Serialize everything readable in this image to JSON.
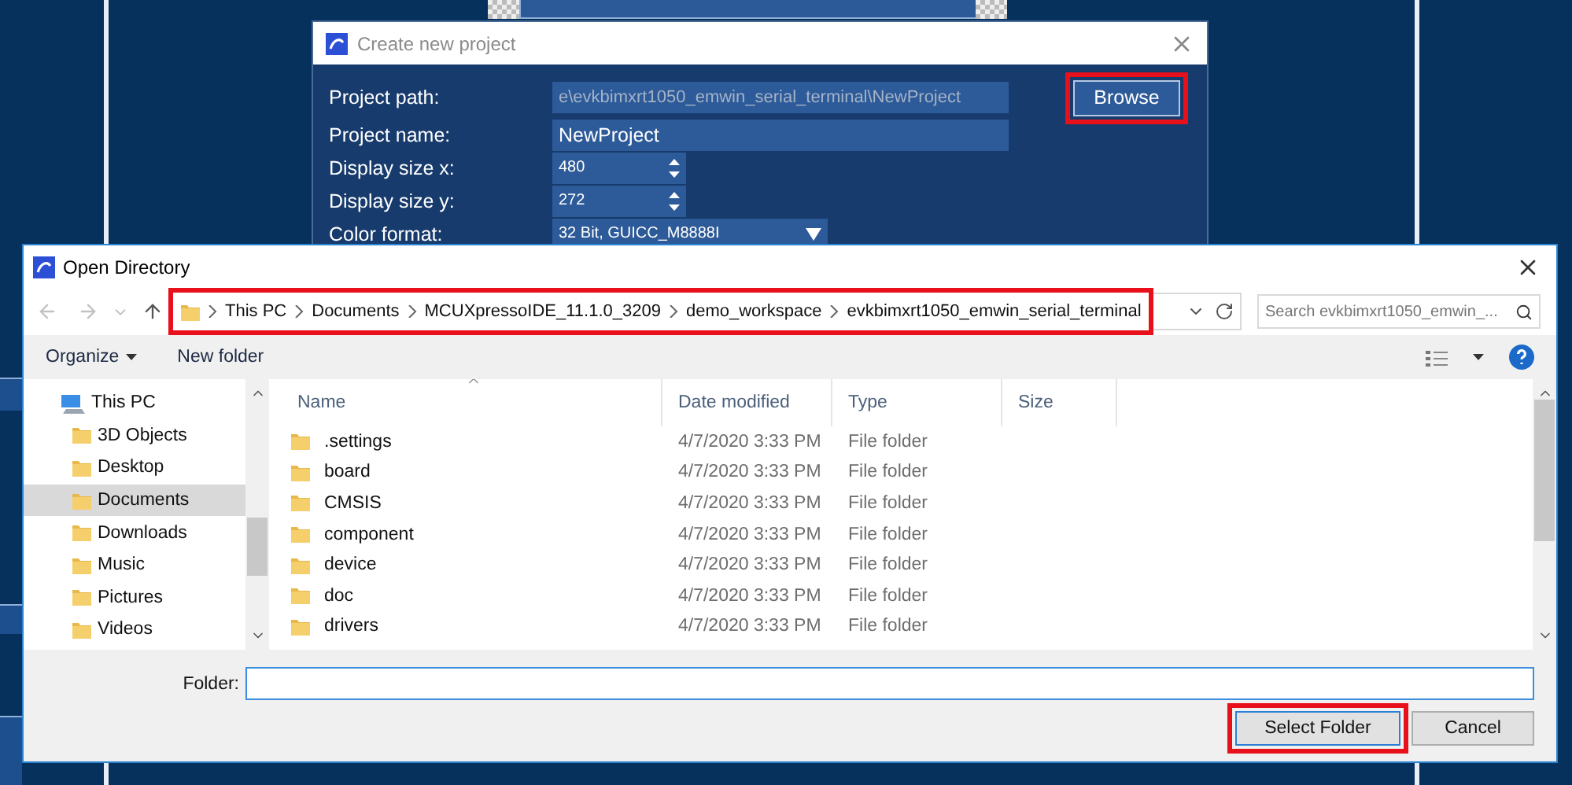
{
  "project_dialog": {
    "title": "Create new project",
    "fields": [
      {
        "label": "Project path:",
        "value": "e\\evkbimxrt1050_emwin_serial_terminal\\NewProject",
        "kind": "text",
        "disabled": true
      },
      {
        "label": "Project name:",
        "value": "NewProject",
        "kind": "text",
        "disabled": false
      },
      {
        "label": "Display size x:",
        "value": "480",
        "kind": "spin",
        "disabled": false
      },
      {
        "label": "Display size y:",
        "value": "272",
        "kind": "spin",
        "disabled": false
      },
      {
        "label": "Color format:",
        "value": "32 Bit, GUICC_M8888I",
        "kind": "select",
        "disabled": false
      }
    ],
    "browse_button": {
      "label": "Browse",
      "highlighted": true
    }
  },
  "open_dialog": {
    "title": "Open Directory",
    "breadcrumb": {
      "highlighted": true,
      "items": [
        "This PC",
        "Documents",
        "MCUXpressoIDE_11.1.0_3209",
        "demo_workspace",
        "evkbimxrt1050_emwin_serial_terminal"
      ]
    },
    "search": {
      "placeholder": "Search evkbimxrt1050_emwin_..."
    },
    "toolbar": [
      {
        "label": "Organize",
        "menu": true
      },
      {
        "label": "New folder",
        "menu": false
      }
    ],
    "sidebar": {
      "items": [
        {
          "label": "This PC",
          "selected": false,
          "children": [
            {
              "label": "3D Objects",
              "selected": false
            },
            {
              "label": "Desktop",
              "selected": false
            },
            {
              "label": "Documents",
              "selected": true
            },
            {
              "label": "Downloads",
              "selected": false
            },
            {
              "label": "Music",
              "selected": false
            },
            {
              "label": "Pictures",
              "selected": false
            },
            {
              "label": "Videos",
              "selected": false
            }
          ]
        }
      ]
    },
    "columns": [
      "Name",
      "Date modified",
      "Type",
      "Size"
    ],
    "rows": [
      {
        "name": ".settings",
        "date": "4/7/2020 3:33 PM",
        "type": "File folder"
      },
      {
        "name": "board",
        "date": "4/7/2020 3:33 PM",
        "type": "File folder"
      },
      {
        "name": "CMSIS",
        "date": "4/7/2020 3:33 PM",
        "type": "File folder"
      },
      {
        "name": "component",
        "date": "4/7/2020 3:33 PM",
        "type": "File folder"
      },
      {
        "name": "device",
        "date": "4/7/2020 3:33 PM",
        "type": "File folder"
      },
      {
        "name": "doc",
        "date": "4/7/2020 3:33 PM",
        "type": "File folder"
      },
      {
        "name": "drivers",
        "date": "4/7/2020 3:33 PM",
        "type": "File folder"
      }
    ],
    "folder_field": {
      "label": "Folder:"
    },
    "buttons": [
      {
        "label": "Select Folder",
        "kind": "primary",
        "highlighted": true
      },
      {
        "label": "Cancel",
        "kind": "default",
        "highlighted": false
      }
    ]
  }
}
